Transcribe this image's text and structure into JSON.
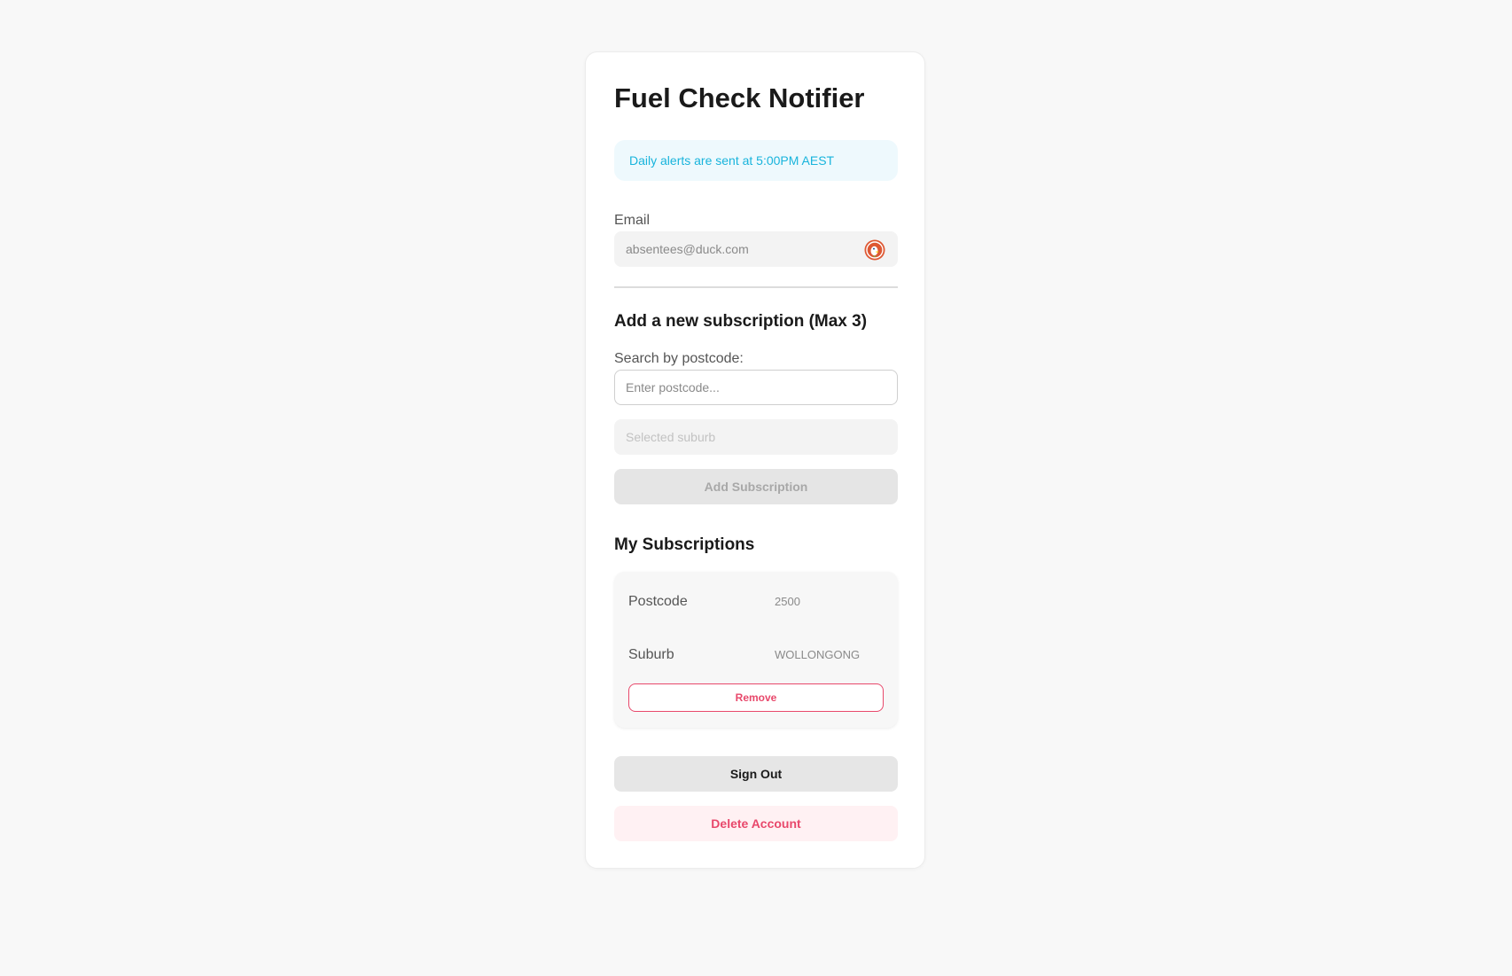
{
  "app": {
    "title": "Fuel Check Notifier"
  },
  "banner": {
    "text": "Daily alerts are sent at 5:00PM AEST"
  },
  "email": {
    "label": "Email",
    "value": "absentees@duck.com",
    "icon": "duckduckgo-icon"
  },
  "add_subscription": {
    "title": "Add a new subscription (Max 3)",
    "search_label": "Search by postcode:",
    "postcode_placeholder": "Enter postcode...",
    "suburb_placeholder": "Selected suburb",
    "button_label": "Add Subscription"
  },
  "subscriptions": {
    "title": "My Subscriptions",
    "items": [
      {
        "postcode_label": "Postcode",
        "postcode": "2500",
        "suburb_label": "Suburb",
        "suburb": "WOLLONGONG",
        "remove_label": "Remove"
      }
    ]
  },
  "account": {
    "sign_out_label": "Sign Out",
    "delete_label": "Delete Account"
  },
  "colors": {
    "accent_info": "#18b4dc",
    "danger": "#e8486b",
    "background": "#f8f8f8"
  }
}
